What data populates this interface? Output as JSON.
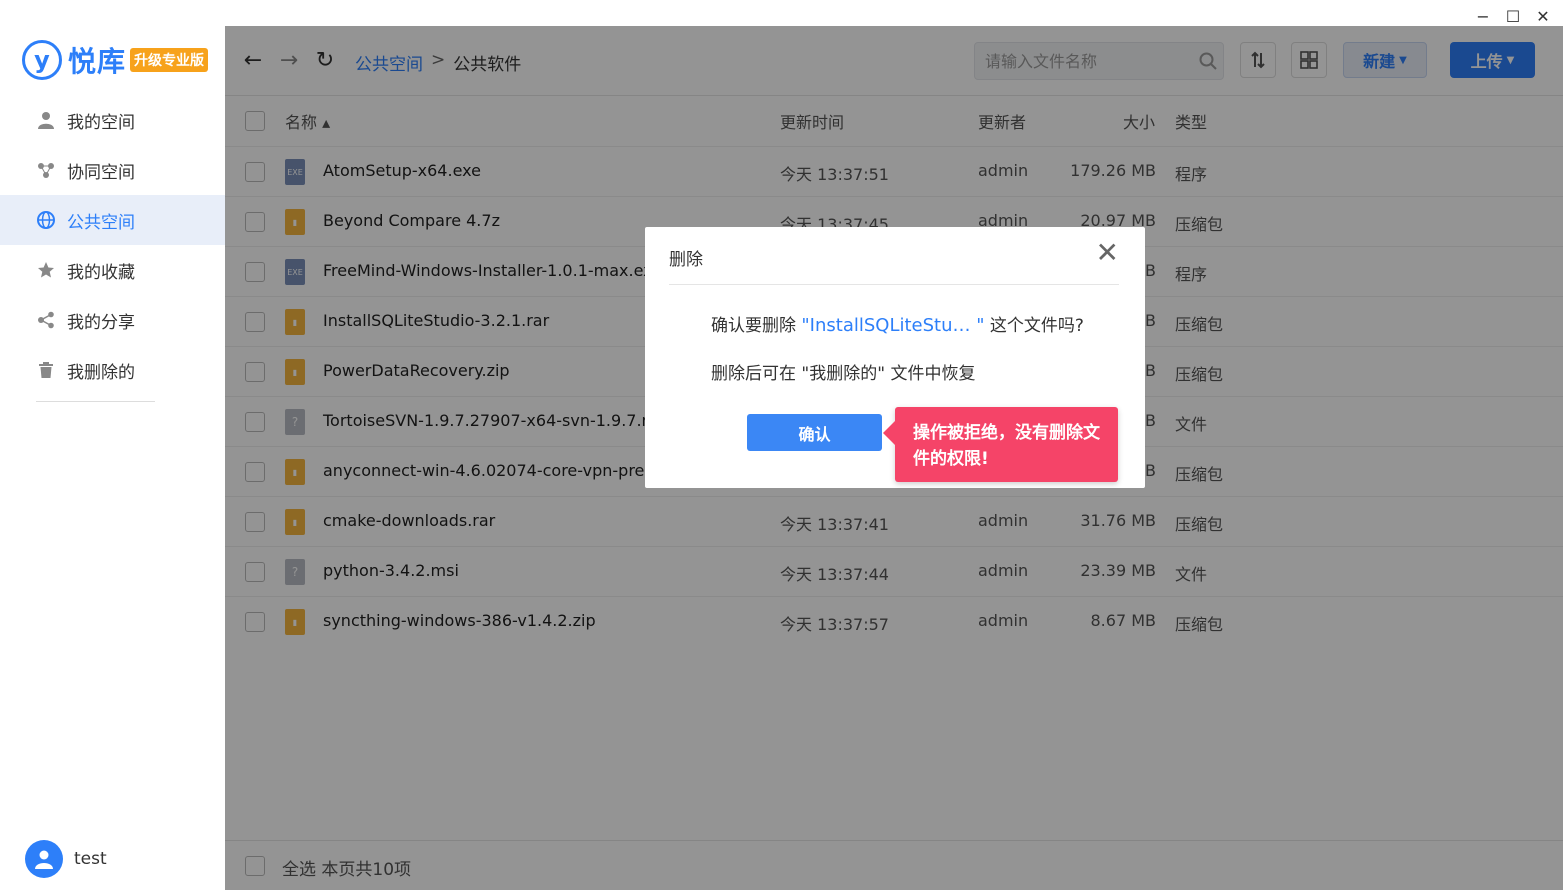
{
  "logo": {
    "letter": "y",
    "text": "悦库",
    "badge": "升级专业版"
  },
  "sidebar": {
    "items": [
      {
        "label": "我的空间",
        "icon": "person-icon"
      },
      {
        "label": "协同空间",
        "icon": "network-icon"
      },
      {
        "label": "公共空间",
        "icon": "globe-icon",
        "active": true
      },
      {
        "label": "我的收藏",
        "icon": "star-icon"
      },
      {
        "label": "我的分享",
        "icon": "share-icon"
      },
      {
        "label": "我删除的",
        "icon": "trash-icon"
      }
    ],
    "user": {
      "name": "test"
    }
  },
  "window": {
    "minimize": "−",
    "maximize": "☐",
    "close": "✕"
  },
  "toolbar": {
    "breadcrumb": {
      "root": "公共空间",
      "separator": ">",
      "current": "公共软件"
    },
    "search": {
      "placeholder": "请输入文件名称"
    },
    "new_label": "新建",
    "upload_label": "上传"
  },
  "table": {
    "headers": {
      "name": "名称 ▴",
      "time": "更新时间",
      "user": "更新者",
      "size": "大小",
      "type": "类型"
    },
    "rows": [
      {
        "name": "AtomSetup-x64.exe",
        "time": "今天 13:37:51",
        "user": "admin",
        "size": "179.26 MB",
        "type": "程序",
        "icon": "exe"
      },
      {
        "name": "Beyond Compare 4.7z",
        "time": "今天 13:37:45",
        "user": "admin",
        "size": "20.97 MB",
        "type": "压缩包",
        "icon": "zip"
      },
      {
        "name": "FreeMind-Windows-Installer-1.0.1-max.exe",
        "time": "",
        "user": "",
        "size": "B",
        "type": "程序",
        "icon": "exe"
      },
      {
        "name": "InstallSQLiteStudio-3.2.1.rar",
        "time": "",
        "user": "",
        "size": "B",
        "type": "压缩包",
        "icon": "zip"
      },
      {
        "name": "PowerDataRecovery.zip",
        "time": "",
        "user": "",
        "size": "B",
        "type": "压缩包",
        "icon": "zip"
      },
      {
        "name": "TortoiseSVN-1.9.7.27907-x64-svn-1.9.7.msi",
        "time": "",
        "user": "",
        "size": "B",
        "type": "文件",
        "icon": "unknown"
      },
      {
        "name": "anyconnect-win-4.6.02074-core-vpn-predeploy",
        "time": "",
        "user": "",
        "size": "B",
        "type": "压缩包",
        "icon": "zip"
      },
      {
        "name": "cmake-downloads.rar",
        "time": "今天 13:37:41",
        "user": "admin",
        "size": "31.76 MB",
        "type": "压缩包",
        "icon": "zip"
      },
      {
        "name": "python-3.4.2.msi",
        "time": "今天 13:37:44",
        "user": "admin",
        "size": "23.39 MB",
        "type": "文件",
        "icon": "unknown"
      },
      {
        "name": "syncthing-windows-386-v1.4.2.zip",
        "time": "今天 13:37:57",
        "user": "admin",
        "size": "8.67 MB",
        "type": "压缩包",
        "icon": "zip"
      }
    ]
  },
  "footer": {
    "text": "全选  本页共10项"
  },
  "dialog": {
    "title": "删除",
    "close": "✕",
    "line1_prefix": "确认要删除 ",
    "file_name": "\"InstallSQLiteStu… \"",
    "line1_suffix": " 这个文件吗?",
    "line2": "删除后可在 \"我删除的\" 文件中恢复",
    "confirm_label": "确认"
  },
  "toast": {
    "text": "操作被拒绝，没有删除文件的权限!"
  }
}
